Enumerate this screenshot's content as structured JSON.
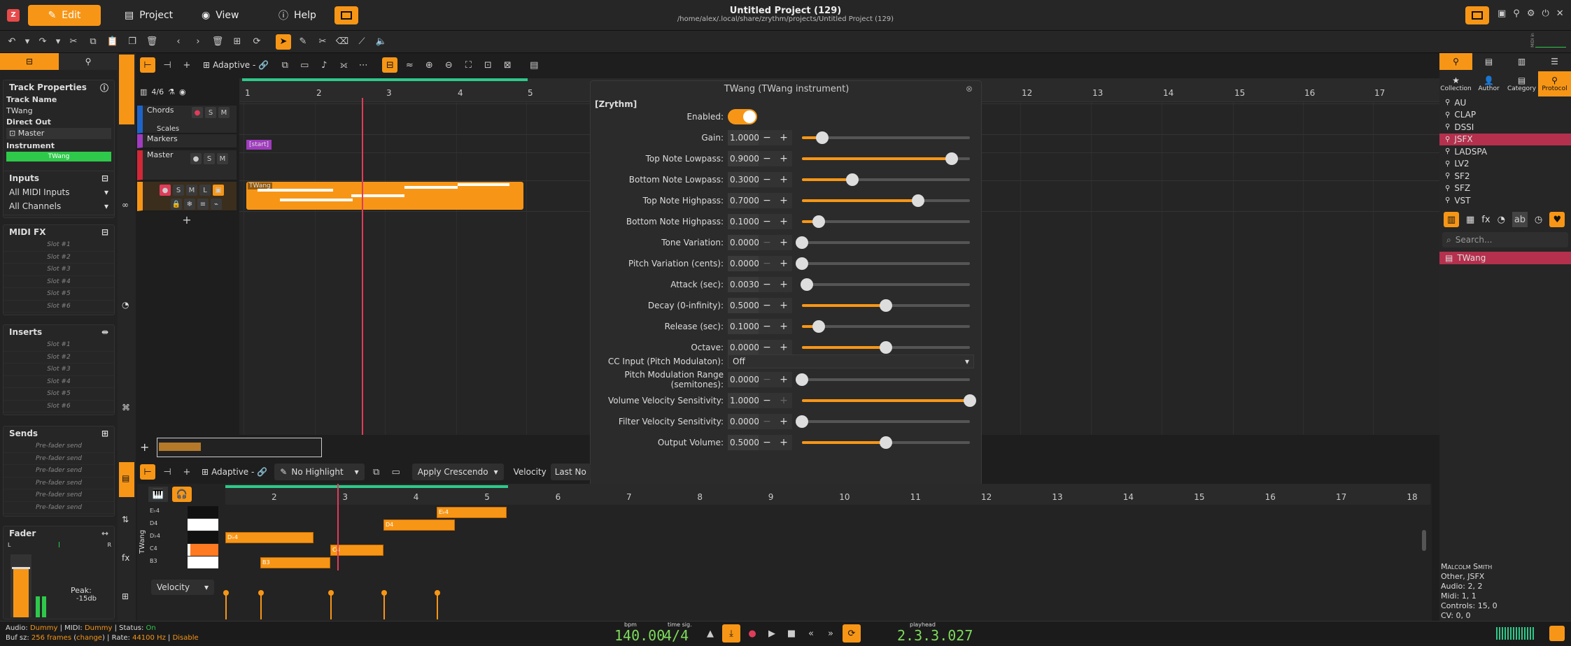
{
  "window": {
    "title": "Untitled Project (129)",
    "path": "/home/alex/.local/share/zrythm/projects/Untitled Project (129)"
  },
  "menu": {
    "edit": "Edit",
    "project": "Project",
    "view": "View",
    "help": "Help"
  },
  "left": {
    "track_properties": "Track Properties",
    "track_name_label": "Track Name",
    "track_name": "TWang",
    "direct_out_label": "Direct Out",
    "direct_out": "Master",
    "instrument_label": "Instrument",
    "instrument": "TWang",
    "inputs": "Inputs",
    "all_midi": "All MIDI Inputs",
    "all_channels": "All Channels",
    "midi_fx": "MIDI FX",
    "midi_slots": [
      "Slot #1",
      "Slot #2",
      "Slot #3",
      "Slot #4",
      "Slot #5",
      "Slot #6"
    ],
    "inserts": "Inserts",
    "insert_slots": [
      "Slot #1",
      "Slot #2",
      "Slot #3",
      "Slot #4",
      "Slot #5",
      "Slot #6"
    ],
    "sends": "Sends",
    "send_slots": [
      "Pre-fader send",
      "Pre-fader send",
      "Pre-fader send",
      "Pre-fader send",
      "Pre-fader send",
      "Pre-fader send"
    ],
    "fader": "Fader",
    "fader_l": "L",
    "fader_r": "R",
    "peak_label": "Peak:",
    "peak_value": "-15db"
  },
  "arranger": {
    "snap": "Adaptive -",
    "tracks_count": "4/6",
    "ruler": [
      "1",
      "2",
      "3",
      "4",
      "5",
      "12",
      "13",
      "14",
      "15",
      "16",
      "17"
    ],
    "tracks": {
      "chords": "Chords",
      "scales": "Scales",
      "markers": "Markers",
      "master": "Master",
      "start_marker": "[start]",
      "region": "TWang"
    }
  },
  "plugin": {
    "title": "TWang (TWang instrument)",
    "section": "[Zrythm]",
    "enabled_label": "Enabled:",
    "params": [
      {
        "label": "Gain:",
        "value": "1.00000",
        "pos": 0.12,
        "plus_dim": false,
        "minus_dim": false
      },
      {
        "label": "Top Note Lowpass:",
        "value": "0.90000",
        "pos": 0.89,
        "plus_dim": false,
        "minus_dim": false
      },
      {
        "label": "Bottom Note Lowpass:",
        "value": "0.30000",
        "pos": 0.3,
        "plus_dim": false,
        "minus_dim": false
      },
      {
        "label": "Top Note Highpass:",
        "value": "0.70000",
        "pos": 0.69,
        "plus_dim": false,
        "minus_dim": false
      },
      {
        "label": "Bottom Note Highpass:",
        "value": "0.10000",
        "pos": 0.1,
        "plus_dim": false,
        "minus_dim": false
      },
      {
        "label": "Tone Variation:",
        "value": "0.00000",
        "pos": 0.0,
        "plus_dim": false,
        "minus_dim": true
      },
      {
        "label": "Pitch Variation (cents):",
        "value": "0.00000",
        "pos": 0.0,
        "plus_dim": false,
        "minus_dim": true
      },
      {
        "label": "Attack (sec):",
        "value": "0.00300",
        "pos": 0.03,
        "plus_dim": false,
        "minus_dim": false
      },
      {
        "label": "Decay (0-infinity):",
        "value": "0.50000",
        "pos": 0.5,
        "plus_dim": false,
        "minus_dim": false
      },
      {
        "label": "Release (sec):",
        "value": "0.10000",
        "pos": 0.1,
        "plus_dim": false,
        "minus_dim": false
      },
      {
        "label": "Octave:",
        "value": "0.00000",
        "pos": 0.5,
        "plus_dim": false,
        "minus_dim": false
      }
    ],
    "cc_label": "CC Input (Pitch Modulaton):",
    "cc_value": "Off",
    "params2": [
      {
        "label": "Pitch Modulation Range (semitones):",
        "value": "0.00000",
        "pos": 0.0,
        "plus_dim": false,
        "minus_dim": true
      },
      {
        "label": "Volume Velocity Sensitivity:",
        "value": "1.00000",
        "pos": 1.0,
        "plus_dim": true,
        "minus_dim": false
      },
      {
        "label": "Filter Velocity Sensitivity:",
        "value": "0.00000",
        "pos": 0.0,
        "plus_dim": false,
        "minus_dim": true
      },
      {
        "label": "Output Volume:",
        "value": "0.50000",
        "pos": 0.5,
        "plus_dim": false,
        "minus_dim": false
      }
    ]
  },
  "editor": {
    "snap": "Adaptive -",
    "highlight": "No Highlight",
    "crescendo": "Apply Crescendo",
    "velocity_label": "Velocity",
    "last_note": "Last No",
    "track_label": "TWang",
    "velocity_select": "Velocity",
    "ruler": [
      "2",
      "3",
      "4",
      "5",
      "6",
      "7",
      "8",
      "9",
      "10",
      "11",
      "12",
      "13",
      "14",
      "15",
      "16",
      "17",
      "18"
    ],
    "keys": [
      "E♭4",
      "D4",
      "D♭4",
      "C4",
      "B3"
    ],
    "notes": [
      "E♭4",
      "D4",
      "D♭4",
      "C4",
      "B3"
    ]
  },
  "right": {
    "tabs": [
      "Collection",
      "Author",
      "Category",
      "Protocol"
    ],
    "protocols": [
      "AU",
      "CLAP",
      "DSSI",
      "JSFX",
      "LADSPA",
      "LV2",
      "SF2",
      "SFZ",
      "VST"
    ],
    "search_placeholder": "Search...",
    "plugin_list": [
      "TWang"
    ],
    "info": [
      "Malcolm Smith",
      "Other, JSFX",
      "Audio: 2, 2",
      "Midi: 1, 1",
      "Controls: 15, 0",
      "CV: 0, 0"
    ],
    "midi_in": "MIDI in"
  },
  "status": {
    "line1_a": "Audio: ",
    "audio": "Dummy",
    "line1_b": " | MIDI: ",
    "midi": "Dummy",
    "line1_c": " | Status: ",
    "status": "On",
    "line2_a": "Buf sz: ",
    "buf": "256 frames",
    "change": "change",
    "line2_b": " | Rate: ",
    "rate": "44100 Hz",
    "disable": "Disable",
    "bpm_label": "bpm",
    "bpm": "140.00",
    "timesig_label": "time sig.",
    "timesig": "4/4",
    "playhead_label": "playhead",
    "playhead": "2.3.3.027"
  },
  "colors": {
    "accent": "#f79616",
    "selected": "#b4304d",
    "lcd": "#7ddc5a"
  }
}
